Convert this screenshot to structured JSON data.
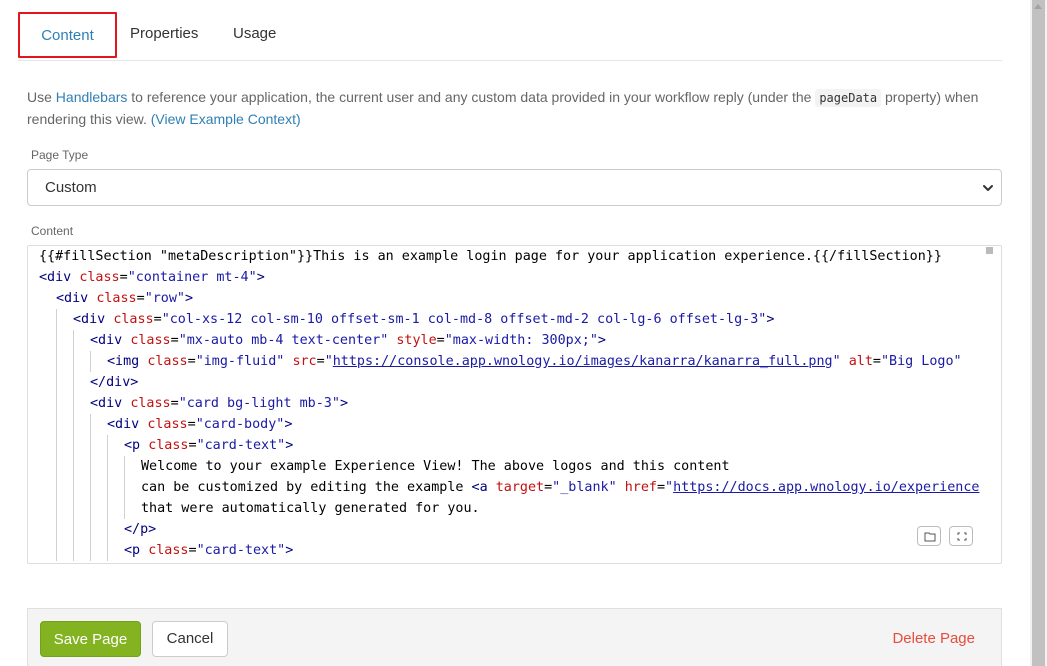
{
  "tabs": [
    {
      "label": "Content"
    },
    {
      "label": "Properties"
    },
    {
      "label": "Usage"
    }
  ],
  "intro": {
    "pre": "Use ",
    "link1": "Handlebars",
    "mid": " to reference your application, the current user and any custom data provided in your workflow reply (under the ",
    "code": "pageData",
    "post": " property) when rendering this view. ",
    "link2": "(View Example Context)"
  },
  "page_type": {
    "label": "Page Type",
    "value": "Custom"
  },
  "content": {
    "label": "Content",
    "lines": [
      {
        "indent": 0,
        "tokens": [
          [
            "t",
            "{{#fillSection \"metaDescription\"}}This is an example login page for your application experience.{{/fillSection}}"
          ]
        ]
      },
      {
        "indent": 0,
        "tokens": [
          [
            "tag",
            "<div "
          ],
          [
            "attr",
            "class"
          ],
          [
            "t",
            "="
          ],
          [
            "str",
            "\"container mt-4\""
          ],
          [
            "tag",
            ">"
          ]
        ]
      },
      {
        "indent": 1,
        "tokens": [
          [
            "tag",
            "<div "
          ],
          [
            "attr",
            "class"
          ],
          [
            "t",
            "="
          ],
          [
            "str",
            "\"row\""
          ],
          [
            "tag",
            ">"
          ]
        ]
      },
      {
        "indent": 2,
        "tokens": [
          [
            "tag",
            "<div "
          ],
          [
            "attr",
            "class"
          ],
          [
            "t",
            "="
          ],
          [
            "str",
            "\"col-xs-12 col-sm-10 offset-sm-1 col-md-8 offset-md-2 col-lg-6 offset-lg-3\""
          ],
          [
            "tag",
            ">"
          ]
        ]
      },
      {
        "indent": 3,
        "tokens": [
          [
            "tag",
            "<div "
          ],
          [
            "attr",
            "class"
          ],
          [
            "t",
            "="
          ],
          [
            "str",
            "\"mx-auto mb-4 text-center\""
          ],
          [
            "t",
            " "
          ],
          [
            "attr",
            "style"
          ],
          [
            "t",
            "="
          ],
          [
            "str",
            "\"max-width: 300px;\""
          ],
          [
            "tag",
            ">"
          ]
        ]
      },
      {
        "indent": 4,
        "tokens": [
          [
            "tag",
            "<img "
          ],
          [
            "attr",
            "class"
          ],
          [
            "t",
            "="
          ],
          [
            "str",
            "\"img-fluid\""
          ],
          [
            "t",
            " "
          ],
          [
            "attr",
            "src"
          ],
          [
            "t",
            "="
          ],
          [
            "str",
            "\""
          ],
          [
            "url",
            "https://console.app.wnology.io/images/kanarra/kanarra_full.png"
          ],
          [
            "str",
            "\""
          ],
          [
            "t",
            " "
          ],
          [
            "attr",
            "alt"
          ],
          [
            "t",
            "="
          ],
          [
            "str",
            "\"Big Logo\""
          ]
        ]
      },
      {
        "indent": 3,
        "tokens": [
          [
            "tag",
            "</div>"
          ]
        ]
      },
      {
        "indent": 3,
        "tokens": [
          [
            "tag",
            "<div "
          ],
          [
            "attr",
            "class"
          ],
          [
            "t",
            "="
          ],
          [
            "str",
            "\"card bg-light mb-3\""
          ],
          [
            "tag",
            ">"
          ]
        ]
      },
      {
        "indent": 4,
        "tokens": [
          [
            "tag",
            "<div "
          ],
          [
            "attr",
            "class"
          ],
          [
            "t",
            "="
          ],
          [
            "str",
            "\"card-body\""
          ],
          [
            "tag",
            ">"
          ]
        ]
      },
      {
        "indent": 5,
        "tokens": [
          [
            "tag",
            "<p "
          ],
          [
            "attr",
            "class"
          ],
          [
            "t",
            "="
          ],
          [
            "str",
            "\"card-text\""
          ],
          [
            "tag",
            ">"
          ]
        ]
      },
      {
        "indent": 6,
        "tokens": [
          [
            "t",
            "Welcome to your example Experience View! The above logos and this content"
          ]
        ]
      },
      {
        "indent": 6,
        "tokens": [
          [
            "t",
            "can be customized by editing the example "
          ],
          [
            "tag",
            "<a "
          ],
          [
            "attr",
            "target"
          ],
          [
            "t",
            "="
          ],
          [
            "str",
            "\"_blank\""
          ],
          [
            "t",
            " "
          ],
          [
            "attr",
            "href"
          ],
          [
            "t",
            "="
          ],
          [
            "str",
            "\""
          ],
          [
            "url",
            "https://docs.app.wnology.io/experience"
          ]
        ]
      },
      {
        "indent": 6,
        "tokens": [
          [
            "t",
            "that were automatically generated for you."
          ]
        ]
      },
      {
        "indent": 5,
        "tokens": [
          [
            "tag",
            "</p>"
          ]
        ]
      },
      {
        "indent": 5,
        "tokens": [
          [
            "tag",
            "<p "
          ],
          [
            "attr",
            "class"
          ],
          [
            "t",
            "="
          ],
          [
            "str",
            "\"card-text\""
          ],
          [
            "tag",
            ">"
          ]
        ]
      }
    ]
  },
  "editor_tools": [
    {
      "icon": "folder-icon"
    },
    {
      "icon": "fullscreen-icon"
    }
  ],
  "footer": {
    "save": "Save Page",
    "cancel": "Cancel",
    "delete": "Delete Page"
  },
  "colors": {
    "accent": "#2f7fb5",
    "save": "#83b321",
    "danger": "#e74c3c",
    "active_tab_outline": "#e0171d"
  }
}
